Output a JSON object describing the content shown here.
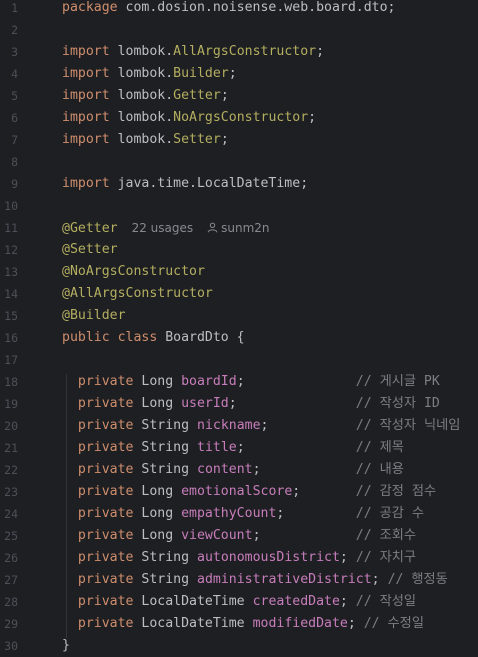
{
  "lines": [
    {
      "n": "1",
      "segs": [
        {
          "t": "package",
          "c": "kw"
        },
        {
          "t": " com.dosion.noisense.web.board.dto;",
          "c": "p"
        }
      ]
    },
    {
      "n": "2",
      "segs": []
    },
    {
      "n": "3",
      "segs": [
        {
          "t": "import",
          "c": "kw"
        },
        {
          "t": " lombok.",
          "c": "p"
        },
        {
          "t": "AllArgsConstructor",
          "c": "ann"
        },
        {
          "t": ";",
          "c": "p"
        }
      ]
    },
    {
      "n": "4",
      "segs": [
        {
          "t": "import",
          "c": "kw"
        },
        {
          "t": " lombok.",
          "c": "p"
        },
        {
          "t": "Builder",
          "c": "ann"
        },
        {
          "t": ";",
          "c": "p"
        }
      ]
    },
    {
      "n": "5",
      "segs": [
        {
          "t": "import",
          "c": "kw"
        },
        {
          "t": " lombok.",
          "c": "p"
        },
        {
          "t": "Getter",
          "c": "ann"
        },
        {
          "t": ";",
          "c": "p"
        }
      ]
    },
    {
      "n": "6",
      "segs": [
        {
          "t": "import",
          "c": "kw"
        },
        {
          "t": " lombok.",
          "c": "p"
        },
        {
          "t": "NoArgsConstructor",
          "c": "ann"
        },
        {
          "t": ";",
          "c": "p"
        }
      ]
    },
    {
      "n": "7",
      "segs": [
        {
          "t": "import",
          "c": "kw"
        },
        {
          "t": " lombok.",
          "c": "p"
        },
        {
          "t": "Setter",
          "c": "ann"
        },
        {
          "t": ";",
          "c": "p"
        }
      ]
    },
    {
      "n": "8",
      "segs": []
    },
    {
      "n": "9",
      "segs": [
        {
          "t": "import",
          "c": "kw"
        },
        {
          "t": " java.time.LocalDateTime;",
          "c": "p"
        }
      ]
    },
    {
      "n": "10",
      "segs": []
    },
    {
      "n": "11",
      "segs": [
        {
          "t": "@Getter",
          "c": "ann"
        }
      ],
      "meta": {
        "usages": "22 usages",
        "author": "sunm2n"
      }
    },
    {
      "n": "12",
      "segs": [
        {
          "t": "@Setter",
          "c": "ann"
        }
      ]
    },
    {
      "n": "13",
      "segs": [
        {
          "t": "@NoArgsConstructor",
          "c": "ann"
        }
      ]
    },
    {
      "n": "14",
      "segs": [
        {
          "t": "@AllArgsConstructor",
          "c": "ann"
        }
      ]
    },
    {
      "n": "15",
      "segs": [
        {
          "t": "@Builder",
          "c": "ann"
        }
      ]
    },
    {
      "n": "16",
      "segs": [
        {
          "t": "public class",
          "c": "kw"
        },
        {
          "t": " BoardDto {",
          "c": "p"
        }
      ]
    },
    {
      "n": "17",
      "segs": []
    },
    {
      "n": "18",
      "segs": [
        {
          "t": "  private",
          "c": "kw"
        },
        {
          "t": " Long ",
          "c": "p"
        },
        {
          "t": "boardId",
          "c": "field"
        },
        {
          "t": ";              ",
          "c": "p"
        },
        {
          "t": "// 게시글 PK",
          "c": "cmt"
        }
      ]
    },
    {
      "n": "19",
      "segs": [
        {
          "t": "  private",
          "c": "kw"
        },
        {
          "t": " Long ",
          "c": "p"
        },
        {
          "t": "userId",
          "c": "field"
        },
        {
          "t": ";               ",
          "c": "p"
        },
        {
          "t": "// 작성자 ID",
          "c": "cmt"
        }
      ]
    },
    {
      "n": "20",
      "segs": [
        {
          "t": "  private",
          "c": "kw"
        },
        {
          "t": " String ",
          "c": "p"
        },
        {
          "t": "nickname",
          "c": "field"
        },
        {
          "t": ";           ",
          "c": "p"
        },
        {
          "t": "// 작성자 닉네임",
          "c": "cmt"
        }
      ]
    },
    {
      "n": "21",
      "segs": [
        {
          "t": "  private",
          "c": "kw"
        },
        {
          "t": " String ",
          "c": "p"
        },
        {
          "t": "title",
          "c": "field"
        },
        {
          "t": ";              ",
          "c": "p"
        },
        {
          "t": "// 제목",
          "c": "cmt"
        }
      ]
    },
    {
      "n": "22",
      "segs": [
        {
          "t": "  private",
          "c": "kw"
        },
        {
          "t": " String ",
          "c": "p"
        },
        {
          "t": "content",
          "c": "field"
        },
        {
          "t": ";            ",
          "c": "p"
        },
        {
          "t": "// 내용",
          "c": "cmt"
        }
      ]
    },
    {
      "n": "23",
      "segs": [
        {
          "t": "  private",
          "c": "kw"
        },
        {
          "t": " Long ",
          "c": "p"
        },
        {
          "t": "emotionalScore",
          "c": "field"
        },
        {
          "t": ";       ",
          "c": "p"
        },
        {
          "t": "// 감정 점수",
          "c": "cmt"
        }
      ]
    },
    {
      "n": "24",
      "segs": [
        {
          "t": "  private",
          "c": "kw"
        },
        {
          "t": " Long ",
          "c": "p"
        },
        {
          "t": "empathyCount",
          "c": "field"
        },
        {
          "t": ";         ",
          "c": "p"
        },
        {
          "t": "// 공감 수",
          "c": "cmt"
        }
      ]
    },
    {
      "n": "25",
      "segs": [
        {
          "t": "  private",
          "c": "kw"
        },
        {
          "t": " Long ",
          "c": "p"
        },
        {
          "t": "viewCount",
          "c": "field"
        },
        {
          "t": ";            ",
          "c": "p"
        },
        {
          "t": "// 조회수",
          "c": "cmt"
        }
      ]
    },
    {
      "n": "26",
      "segs": [
        {
          "t": "  private",
          "c": "kw"
        },
        {
          "t": " String ",
          "c": "p"
        },
        {
          "t": "autonomousDistrict",
          "c": "field"
        },
        {
          "t": "; ",
          "c": "p"
        },
        {
          "t": "// 자치구",
          "c": "cmt"
        }
      ]
    },
    {
      "n": "27",
      "segs": [
        {
          "t": "  private",
          "c": "kw"
        },
        {
          "t": " String ",
          "c": "p"
        },
        {
          "t": "administrativeDistrict",
          "c": "field"
        },
        {
          "t": "; ",
          "c": "p"
        },
        {
          "t": "// 행정동",
          "c": "cmt"
        }
      ]
    },
    {
      "n": "28",
      "segs": [
        {
          "t": "  private",
          "c": "kw"
        },
        {
          "t": " LocalDateTime ",
          "c": "p"
        },
        {
          "t": "createdDate",
          "c": "field"
        },
        {
          "t": "; ",
          "c": "p"
        },
        {
          "t": "// 작성일",
          "c": "cmt"
        }
      ]
    },
    {
      "n": "29",
      "segs": [
        {
          "t": "  private",
          "c": "kw"
        },
        {
          "t": " LocalDateTime ",
          "c": "p"
        },
        {
          "t": "modifiedDate",
          "c": "field"
        },
        {
          "t": "; ",
          "c": "p"
        },
        {
          "t": "// 수정일",
          "c": "cmt"
        }
      ]
    },
    {
      "n": "30",
      "segs": [
        {
          "t": "}",
          "c": "p"
        }
      ]
    }
  ],
  "colors": {
    "background": "#1e1f22",
    "keyword": "#cf8e6d",
    "annotation": "#b3ae60",
    "field": "#c77dbb",
    "comment": "#7a7e85",
    "plain": "#bcbec4",
    "line_number": "#4b5059"
  },
  "icons": {
    "author": "person-icon"
  }
}
